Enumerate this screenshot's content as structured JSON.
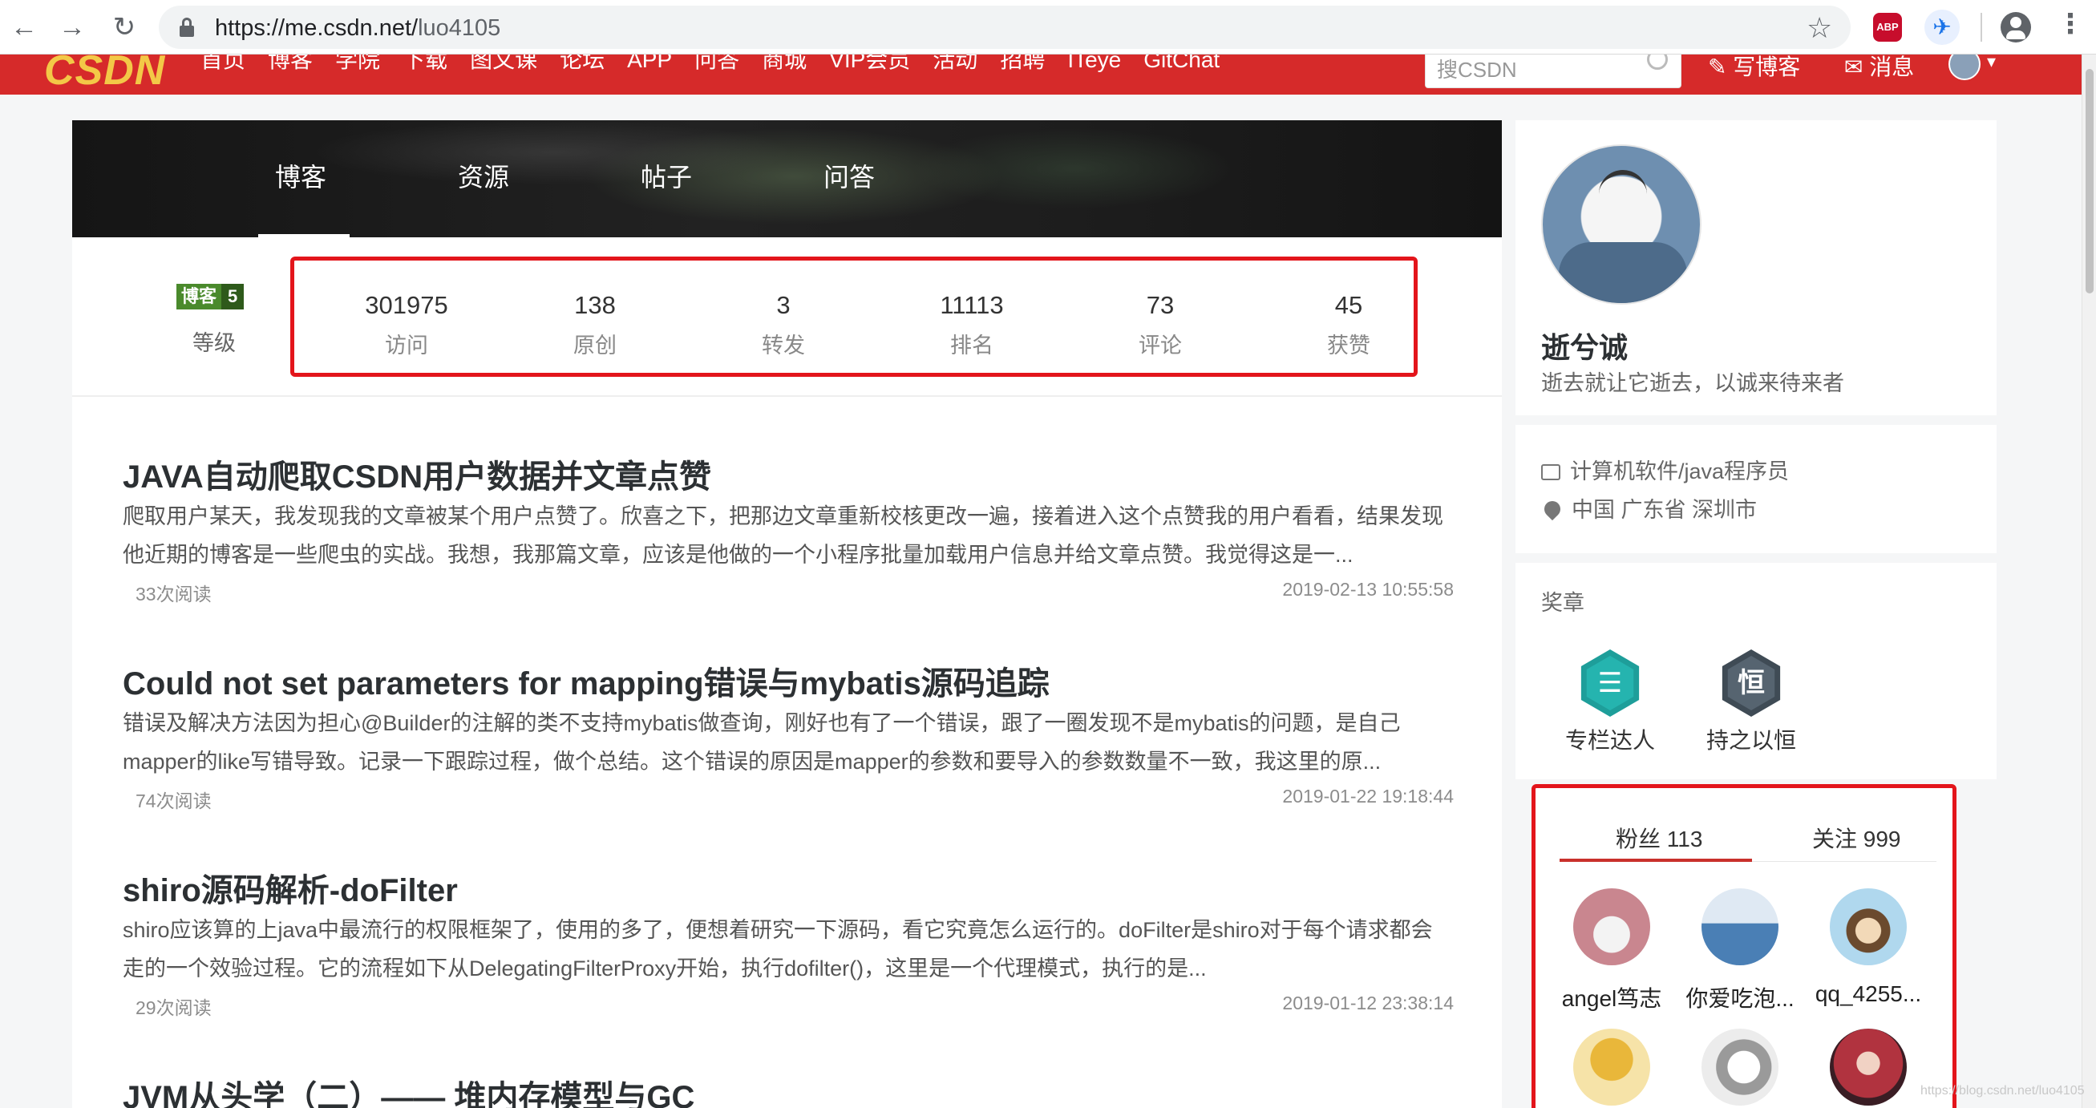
{
  "browser": {
    "url_host": "https://me.csdn.net/",
    "url_path": "luo4105"
  },
  "toolbar": {
    "logo": "CSDN",
    "nav": [
      "首页",
      "博客",
      "学院",
      "下载",
      "图文课",
      "论坛",
      "APP",
      "问答",
      "商城",
      "VIP会员",
      "活动",
      "招聘",
      "ITeye",
      "GitChat"
    ],
    "search_placeholder": "搜CSDN",
    "write_blog": "写博客",
    "messages": "消息"
  },
  "banner_tabs": [
    "博客",
    "资源",
    "帖子",
    "问答"
  ],
  "level": {
    "badge_text": "博客",
    "badge_level": "5",
    "label": "等级"
  },
  "stats": [
    {
      "value": "301975",
      "label": "访问"
    },
    {
      "value": "138",
      "label": "原创"
    },
    {
      "value": "3",
      "label": "转发"
    },
    {
      "value": "11113",
      "label": "排名"
    },
    {
      "value": "73",
      "label": "评论"
    },
    {
      "value": "45",
      "label": "获赞"
    }
  ],
  "articles": [
    {
      "title": "JAVA自动爬取CSDN用户数据并文章点赞",
      "desc": "爬取用户某天，我发现我的文章被某个用户点赞了。欣喜之下，把那边文章重新校核更改一遍，接着进入这个点赞我的用户看看，结果发现他近期的博客是一些爬虫的实战。我想，我那篇文章，应该是他做的一个小程序批量加载用户信息并给文章点赞。我觉得这是一...",
      "reads": "33次阅读",
      "date": "2019-02-13 10:55:58"
    },
    {
      "title": "Could not set parameters for mapping错误与mybatis源码追踪",
      "desc": "错误及解决方法因为担心@Builder的注解的类不支持mybatis做查询，刚好也有了一个错误，跟了一圈发现不是mybatis的问题，是自己mapper的like写错导致。记录一下跟踪过程，做个总结。这个错误的原因是mapper的参数和要导入的参数数量不一致，我这里的原...",
      "reads": "74次阅读",
      "date": "2019-01-22 19:18:44"
    },
    {
      "title": "shiro源码解析-doFilter",
      "desc": "shiro应该算的上java中最流行的权限框架了，使用的多了，便想着研究一下源码，看它究竟怎么运行的。doFilter是shiro对于每个请求都会走的一个效验过程。它的流程如下从DelegatingFilterProxy开始，执行dofilter()，这里是一个代理模式，执行的是...",
      "reads": "29次阅读",
      "date": "2019-01-12 23:38:14"
    },
    {
      "title": "JVM从头学（二）—— 堆内存模型与GC",
      "desc": "",
      "reads": "",
      "date": ""
    }
  ],
  "profile": {
    "name": "逝兮诚",
    "bio": "逝去就让它逝去，以诚来待来者",
    "job": "计算机软件/java程序员",
    "location": "中国 广东省 深圳市"
  },
  "medals": {
    "title": "奖章",
    "items": [
      {
        "glyph": "☰",
        "label": "专栏达人",
        "color": "#1e9e9a"
      },
      {
        "glyph": "恒",
        "label": "持之以恒",
        "color": "#3f4b55"
      }
    ]
  },
  "fans": {
    "fans_tab": "粉丝 113",
    "follow_tab": "关注 999",
    "users": [
      {
        "name": "angel笃志",
        "color": "#c9868f"
      },
      {
        "name": "你爱吃泡...",
        "color": "#4a7fb5"
      },
      {
        "name": "qq_4255...",
        "color": "#b0d8ee"
      },
      {
        "name": "",
        "color": "#e9b73a"
      },
      {
        "name": "",
        "color": "#9a9a9a"
      },
      {
        "name": "",
        "color": "#b1333f"
      }
    ]
  },
  "watermark": "https://blog.csdn.net/luo4105"
}
